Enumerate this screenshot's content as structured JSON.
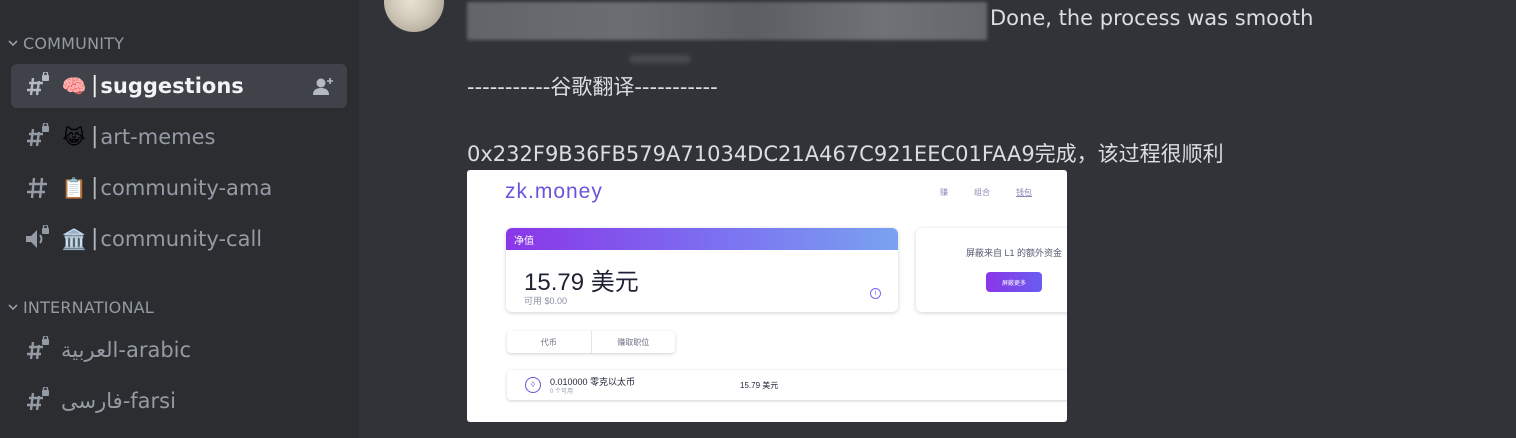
{
  "sidebar": {
    "categories": [
      {
        "label": "COMMUNITY"
      },
      {
        "label": "INTERNATIONAL"
      }
    ],
    "channels": [
      {
        "emoji": "🧠",
        "name": "suggestions",
        "active": true,
        "icon": "hashtag-locked-icon"
      },
      {
        "emoji": "😹",
        "name": "art-memes",
        "icon": "hashtag-locked-icon"
      },
      {
        "emoji": "📋",
        "name": "community-ama",
        "icon": "hashtag-icon"
      },
      {
        "emoji": "🏛️",
        "name": "community-call",
        "icon": "speaker-locked-icon"
      },
      {
        "emoji": "",
        "name": "العربية-arabic",
        "icon": "hashtag-locked-icon"
      },
      {
        "emoji": "",
        "name": "فارسی-farsi",
        "icon": "hashtag-locked-icon"
      }
    ]
  },
  "chat": {
    "line1": "Done, the process was smooth",
    "line2": "-----------谷歌翻译-----------",
    "line3": "0x232F9B36FB579A71034DC21A467C921EEC01FAA9完成，该过程很顺利"
  },
  "attachment": {
    "logo": "zk.money",
    "nav": [
      "赚",
      "组合",
      "钱包"
    ],
    "net_worth_label": "净值",
    "amount": "15.79 美元",
    "available": "可用 $0.00",
    "shield_text": "屏蔽来自 L1 的额外资金",
    "shield_button": "屏蔽更多",
    "tabs": [
      "代币",
      "赚取职位"
    ],
    "asset_balance": "0.010000 零克以太币",
    "asset_sub": "0 个可用",
    "asset_value": "15.79 美元"
  },
  "colors": {
    "sidebar_bg": "#2b2d31",
    "chat_bg": "#313338",
    "active_channel_bg": "#404249",
    "brand_purple": "#6b54d9"
  }
}
